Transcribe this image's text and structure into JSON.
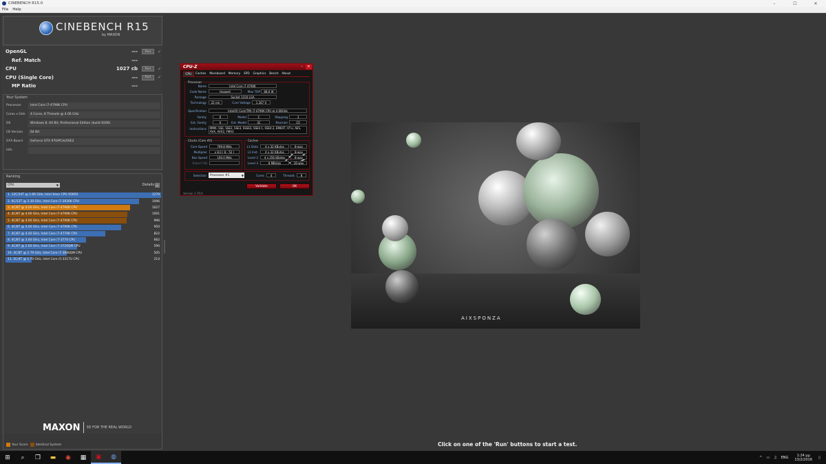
{
  "window": {
    "title": "CINEBENCH R15.0",
    "controls": [
      "–",
      "☐",
      "✕"
    ]
  },
  "menu": [
    "File",
    "Help"
  ],
  "logo": {
    "name": "CINEBENCH R15",
    "sub": "by MAXON"
  },
  "tests": [
    {
      "name": "OpenGL",
      "value": "---",
      "run": "Run",
      "check": "✓"
    },
    {
      "name": "Ref. Match",
      "value": "---"
    },
    {
      "name": "CPU",
      "value": "1027 cb",
      "run": "Run",
      "check": "✓"
    },
    {
      "name": "CPU (Single Core)",
      "value": "---",
      "run": "Run",
      "check": "✓"
    },
    {
      "name": "MP Ratio",
      "value": "---"
    }
  ],
  "your_system": {
    "title": "Your System",
    "rows": [
      {
        "key": "Processor",
        "value": "Intel Core i7-4790K CPU"
      },
      {
        "key": "Cores x GHz",
        "value": "4 Cores, 8 Threads @ 4.00 GHz"
      },
      {
        "key": "OS",
        "value": "Windows 8, 64 Bit, Professional Edition (build 9200)"
      },
      {
        "key": "CB Version",
        "value": "64 Bit"
      },
      {
        "key": "GFX Board",
        "value": "GeForce GTX 970/PCIe/SSE2"
      },
      {
        "key": "Info",
        "value": ""
      }
    ]
  },
  "ranking": {
    "title": "Ranking",
    "selected": "CPU",
    "details_label": "Details",
    "max_score": 1279,
    "rows": [
      {
        "label": "1. 12C/24T @ 2.66 GHz, Intel Xeon CPU X5650",
        "score": "1279",
        "type": "other"
      },
      {
        "label": "2. 6C/12T @ 3.30 GHz,  Intel Core i7-3930K CPU",
        "score": "1096",
        "type": "other"
      },
      {
        "label": "3. 4C/8T @ 4.00 GHz, Intel Core i7-4790K CPU",
        "score": "1027",
        "type": "yours"
      },
      {
        "label": "4. 4C/8T @ 4.00 GHz, Intel Core i7-4790K CPU",
        "score": "1001",
        "type": "identical"
      },
      {
        "label": "5. 4C/8T @ 4.00 GHz, Intel Core i7-4790K CPU",
        "score": "996",
        "type": "identical"
      },
      {
        "label": "6. 4C/8T @ 4.00 GHz, Intel Core i7-4790K CPU",
        "score": "950",
        "type": "other"
      },
      {
        "label": "7. 4C/8T @ 4.40 GHz, Intel Core i7-4770K CPU",
        "score": "822",
        "type": "other"
      },
      {
        "label": "8. 4C/8T @ 3.40 GHz,  Intel Core i7-3770 CPU",
        "score": "662",
        "type": "other"
      },
      {
        "label": "9. 4C/8T @ 2.60 GHz, Intel Core i7-3720QM CPU",
        "score": "590",
        "type": "other"
      },
      {
        "label": "10. 4C/8T @ 2.79 GHz,  Intel Core i7-3840QM CPU",
        "score": "505",
        "type": "other"
      },
      {
        "label": "11. 2C/4T @ 1.70 GHz,  Intel Core i5-3317U CPU",
        "score": "214",
        "type": "other"
      }
    ],
    "legend_your": "Your Score",
    "legend_identical": "Identical System"
  },
  "colors": {
    "other": "#3d6fb4",
    "yours": "#d07a10",
    "identical": "#8a4e0c",
    "cpuz_red": "#9e0f17"
  },
  "footer": {
    "brand": "MAXON",
    "tagline": "3D FOR THE REAL WORLD",
    "status": "Click on one of the 'Run' buttons to start a test."
  },
  "render": {
    "watermark": "AIXSPONZA"
  },
  "cpuz": {
    "title": "CPU-Z",
    "tabs": [
      "CPU",
      "Caches",
      "Mainboard",
      "Memory",
      "SPD",
      "Graphics",
      "Bench",
      "About"
    ],
    "processor": {
      "group": "Processor",
      "name_label": "Name",
      "name": "Intel Core i7 4790K",
      "codename_label": "Code Name",
      "codename": "Haswell",
      "tdp_label": "Max TDP",
      "tdp": "88.0 W",
      "package_label": "Package",
      "package": "Socket 1150 LGA",
      "tech_label": "Technology",
      "tech": "22 nm",
      "voltage_label": "Core Voltage",
      "voltage": "1.347 V",
      "spec_label": "Specification",
      "spec": "Intel(R) Core(TM) i7-4790K CPU @ 4.00GHz",
      "family_label": "Family",
      "family": "6",
      "model_label": "Model",
      "model": "C",
      "stepping_label": "Stepping",
      "stepping": "3",
      "extfamily_label": "Ext. Family",
      "extfamily": "6",
      "extmodel_label": "Ext. Model",
      "extmodel": "3C",
      "revision_label": "Revision",
      "revision": "C0",
      "instr_label": "Instructions",
      "instr": "MMX, SSE, SSE2, SSE3, SSSE3, SSE4.1, SSE4.2, EM64T, VT-x, AES, AVX, AVX2, FMA3"
    },
    "clocks": {
      "group": "Clocks (Core #0)",
      "core_speed_label": "Core Speed",
      "core_speed": "799.8 MHz",
      "multiplier_label": "Multiplier",
      "multiplier": "x 8.0 ( 8 - 52 )",
      "bus_label": "Bus Speed",
      "bus": "100.0 MHz",
      "fsb_label": "Rated FSB",
      "fsb": ""
    },
    "caches": {
      "group": "Caches",
      "rows": [
        {
          "label": "L1 Data",
          "size": "4 x 32 KBytes",
          "way": "8-way"
        },
        {
          "label": "L1 Inst.",
          "size": "4 x 32 KBytes",
          "way": "8-way"
        },
        {
          "label": "Level 2",
          "size": "4 x 256 KBytes",
          "way": "8-way"
        },
        {
          "label": "Level 3",
          "size": "8 MBytes",
          "way": "16-way"
        }
      ]
    },
    "selection_label": "Selection",
    "selection": "Processor #1",
    "cores_label": "Cores",
    "cores": "4",
    "threads_label": "Threads",
    "threads": "8",
    "validate": "Validate",
    "ok": "OK",
    "version": "Version 1.79.0"
  },
  "taskbar": {
    "icons": [
      "windows-start",
      "search",
      "task-view",
      "file-explorer",
      "chrome",
      "calculator",
      "cpuz",
      "cinebench"
    ],
    "tray": [
      "^",
      "▭",
      "♫",
      "ENG"
    ],
    "time": "1:24 μμ",
    "date": "13/2/2016"
  }
}
